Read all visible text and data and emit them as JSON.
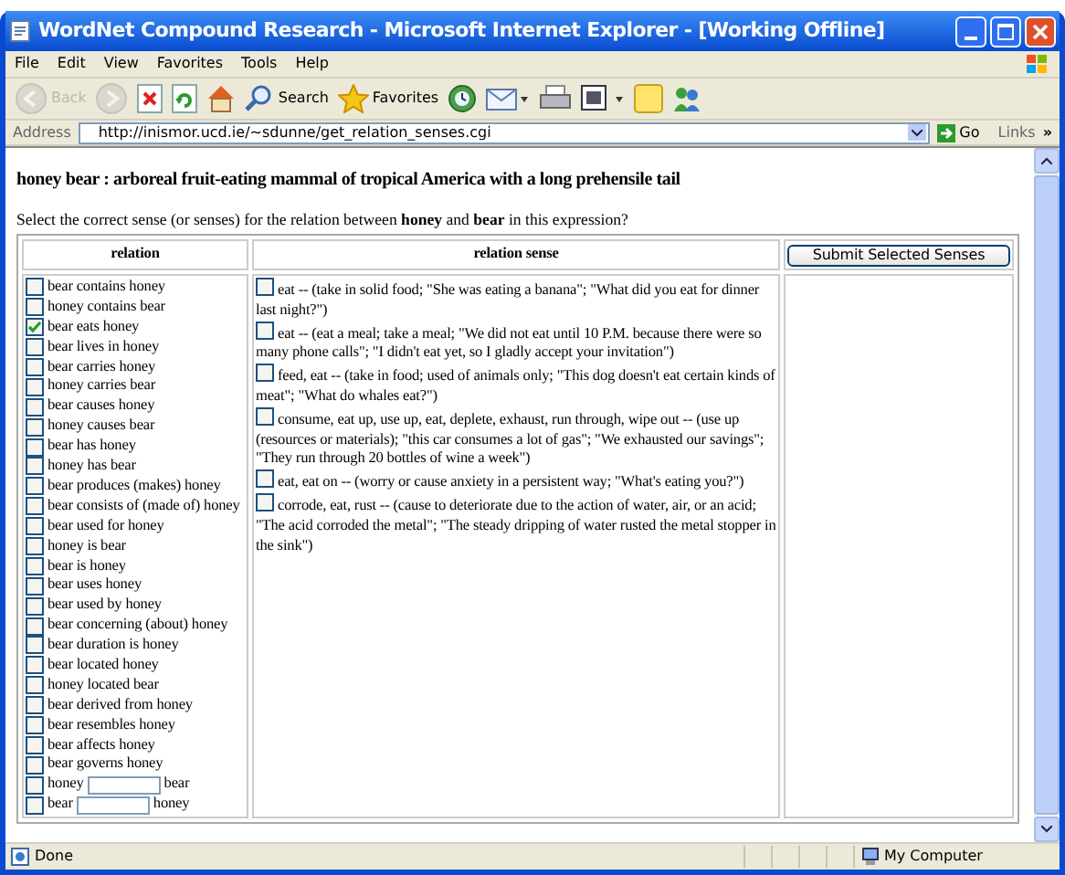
{
  "window": {
    "title": "WordNet Compound Research - Microsoft Internet Explorer - [Working Offline]"
  },
  "menu": [
    "File",
    "Edit",
    "View",
    "Favorites",
    "Tools",
    "Help"
  ],
  "toolbar": [
    {
      "kind": "back",
      "label": "Back",
      "disabled": true
    },
    {
      "kind": "forward",
      "disabled": true
    },
    {
      "kind": "stop"
    },
    {
      "kind": "refresh"
    },
    {
      "kind": "home"
    },
    {
      "kind": "search",
      "label": "Search"
    },
    {
      "kind": "favorites",
      "label": "Favorites"
    },
    {
      "kind": "history"
    },
    {
      "kind": "mail"
    },
    {
      "kind": "print"
    },
    {
      "kind": "edit"
    },
    {
      "kind": "notes"
    },
    {
      "kind": "messenger"
    }
  ],
  "address": {
    "label": "Address",
    "value": "http://inismor.ucd.ie/~sdunne/get_relation_senses.cgi",
    "go": "Go",
    "links": "Links",
    "more": "»"
  },
  "heading": "honey bear : arboreal fruit-eating mammal of tropical America with a long prehensile tail",
  "instruction": "Select the correct sense (or senses) for the relation between **honey** and **bear** in this expression?",
  "table": {
    "columns": [
      "relation",
      "relation sense"
    ],
    "submit": "Submit Selected Senses",
    "relations": [
      {
        "kind": "text",
        "label": "bear contains honey",
        "checked": false
      },
      {
        "kind": "text",
        "label": "honey contains bear",
        "checked": false
      },
      {
        "kind": "text",
        "label": "bear eats honey",
        "checked": true
      },
      {
        "kind": "text",
        "label": "bear lives in honey",
        "checked": false
      },
      {
        "kind": "text",
        "label": "bear carries honey",
        "checked": false
      },
      {
        "kind": "text",
        "label": "honey carries bear",
        "checked": false
      },
      {
        "kind": "text",
        "label": "bear causes honey",
        "checked": false
      },
      {
        "kind": "text",
        "label": "honey causes bear",
        "checked": false
      },
      {
        "kind": "text",
        "label": "bear has honey",
        "checked": false
      },
      {
        "kind": "text",
        "label": "honey has bear",
        "checked": false
      },
      {
        "kind": "text",
        "label": "bear produces (makes) honey",
        "checked": false
      },
      {
        "kind": "text",
        "label": "bear consists of (made of) honey",
        "checked": false
      },
      {
        "kind": "text",
        "label": "bear used for honey",
        "checked": false
      },
      {
        "kind": "text",
        "label": "honey is bear",
        "checked": false
      },
      {
        "kind": "text",
        "label": "bear is honey",
        "checked": false
      },
      {
        "kind": "text",
        "label": "bear uses honey",
        "checked": false
      },
      {
        "kind": "text",
        "label": "bear used by honey",
        "checked": false
      },
      {
        "kind": "text",
        "label": "bear concerning (about) honey",
        "checked": false
      },
      {
        "kind": "text",
        "label": "bear duration is honey",
        "checked": false
      },
      {
        "kind": "text",
        "label": "bear located honey",
        "checked": false
      },
      {
        "kind": "text",
        "label": "honey located bear",
        "checked": false
      },
      {
        "kind": "text",
        "label": "bear derived from honey",
        "checked": false
      },
      {
        "kind": "text",
        "label": "bear resembles honey",
        "checked": false
      },
      {
        "kind": "text",
        "label": "bear affects honey",
        "checked": false
      },
      {
        "kind": "text",
        "label": "bear governs honey",
        "checked": false
      },
      {
        "kind": "blank",
        "before": "honey",
        "after": "bear",
        "checked": false
      },
      {
        "kind": "blank",
        "before": "bear",
        "after": "honey",
        "checked": false
      }
    ],
    "senses": [
      {
        "text": "eat -- (take in solid food; \"She was eating a banana\"; \"What did you eat for dinner last night?\")",
        "checked": false
      },
      {
        "text": "eat -- (eat a meal; take a meal; \"We did not eat until 10 P.M. because there were so many phone calls\"; \"I didn't eat yet, so I gladly accept your invitation\")",
        "checked": false
      },
      {
        "text": "feed, eat -- (take in food; used of animals only; \"This dog doesn't eat certain kinds of meat\"; \"What do whales eat?\")",
        "checked": false
      },
      {
        "text": "consume, eat up, use up, eat, deplete, exhaust, run through, wipe out -- (use up (resources or materials); \"this car consumes a lot of gas\"; \"We exhausted our savings\"; \"They run through 20 bottles of wine a week\")",
        "checked": false
      },
      {
        "text": "eat, eat on -- (worry or cause anxiety in a persistent way; \"What's eating you?\")",
        "checked": false
      },
      {
        "text": "corrode, eat, rust -- (cause to deteriorate due to the action of water, air, or an acid; \"The acid corroded the metal\"; \"The steady dripping of water rusted the metal stopper in the sink\")",
        "checked": false
      }
    ]
  },
  "status_bar": {
    "text": "Done",
    "zone": "My Computer"
  }
}
